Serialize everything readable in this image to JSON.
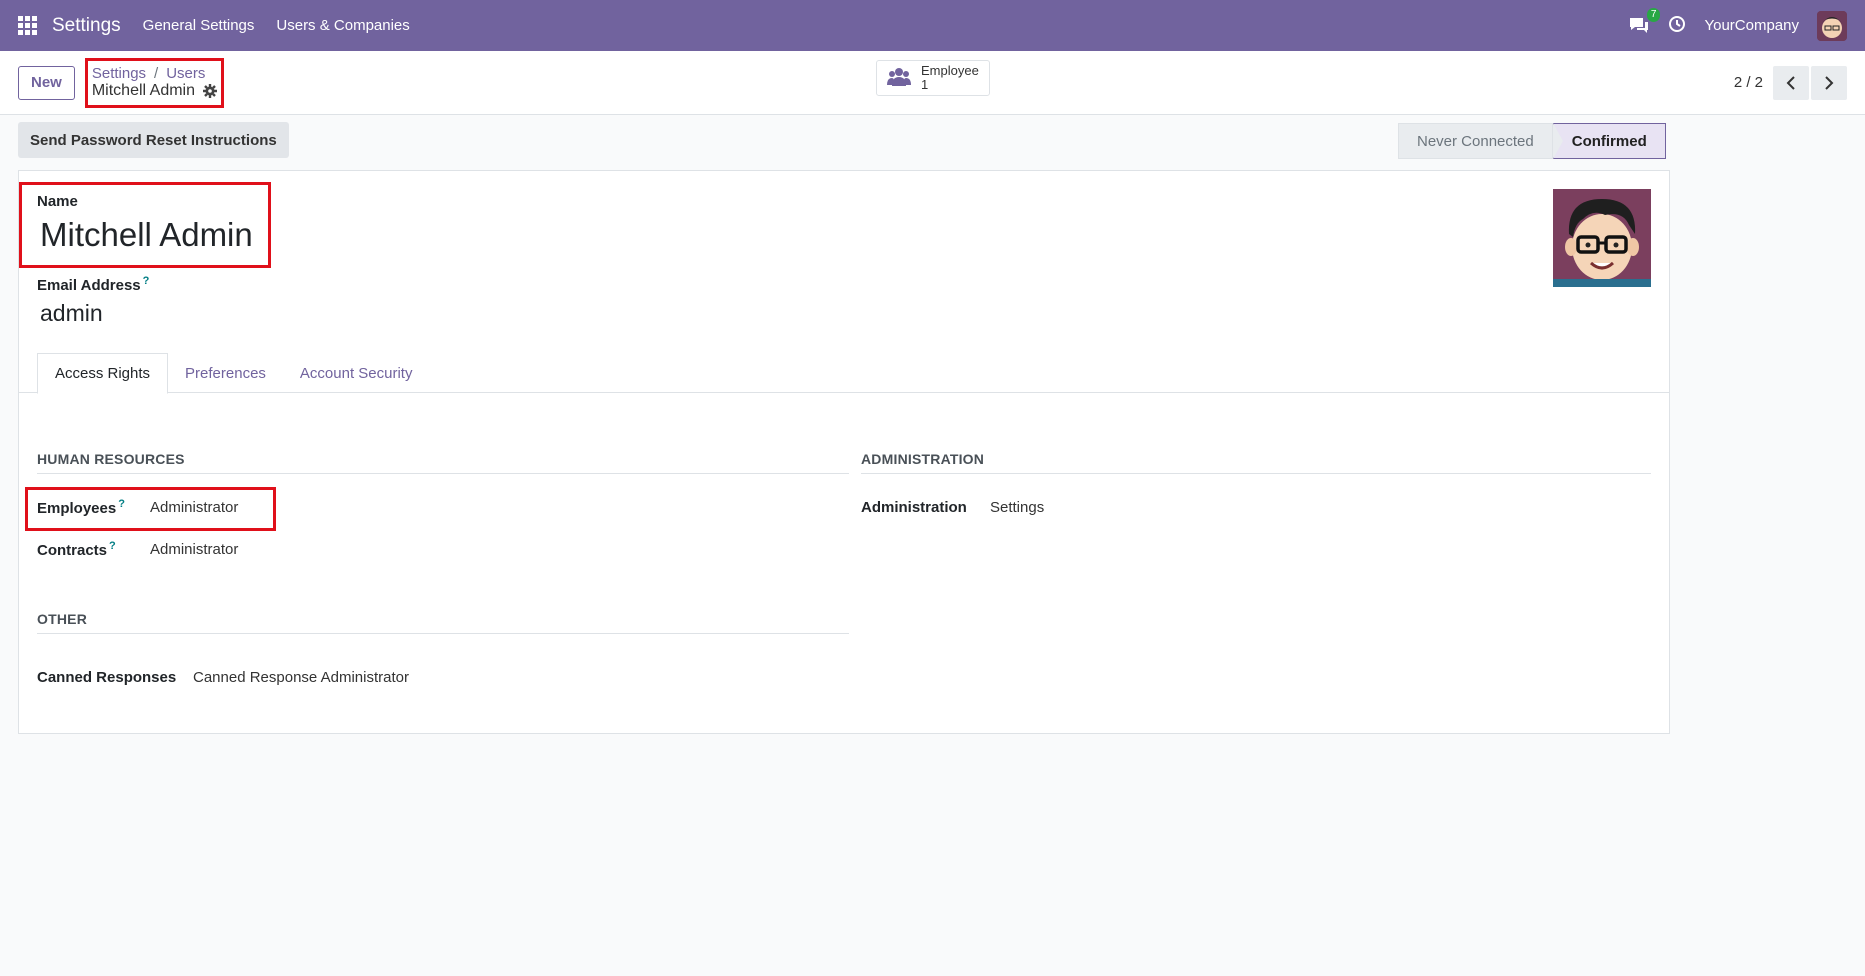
{
  "navbar": {
    "app_title": "Settings",
    "menu": [
      "General Settings",
      "Users & Companies"
    ],
    "chat_count": "7",
    "company": "YourCompany"
  },
  "control": {
    "new_label": "New",
    "breadcrumb": [
      "Settings",
      "Users"
    ],
    "breadcrumb_sep": "/",
    "current_record": "Mitchell Admin",
    "smart_button": {
      "label": "Employee",
      "count": "1"
    },
    "pager": "2 / 2"
  },
  "status": {
    "reset_label": "Send Password Reset Instructions",
    "stages": [
      "Never Connected",
      "Confirmed"
    ],
    "active_stage": "Confirmed"
  },
  "form": {
    "name_label": "Name",
    "name_value": "Mitchell Admin",
    "email_label": "Email Address",
    "email_help": "?",
    "email_value": "admin",
    "tabs": [
      "Access Rights",
      "Preferences",
      "Account Security"
    ],
    "hr": {
      "title": "HUMAN RESOURCES",
      "employees_label": "Employees",
      "employees_value": "Administrator",
      "contracts_label": "Contracts",
      "contracts_value": "Administrator"
    },
    "admin": {
      "title": "ADMINISTRATION",
      "admin_label": "Administration",
      "admin_value": "Settings"
    },
    "other": {
      "title": "OTHER",
      "canned_label": "Canned Responses",
      "canned_value": "Canned Response Administrator"
    }
  },
  "colors": {
    "brand": "#71639e",
    "highlight": "#e0101a",
    "badge": "#28a745"
  }
}
